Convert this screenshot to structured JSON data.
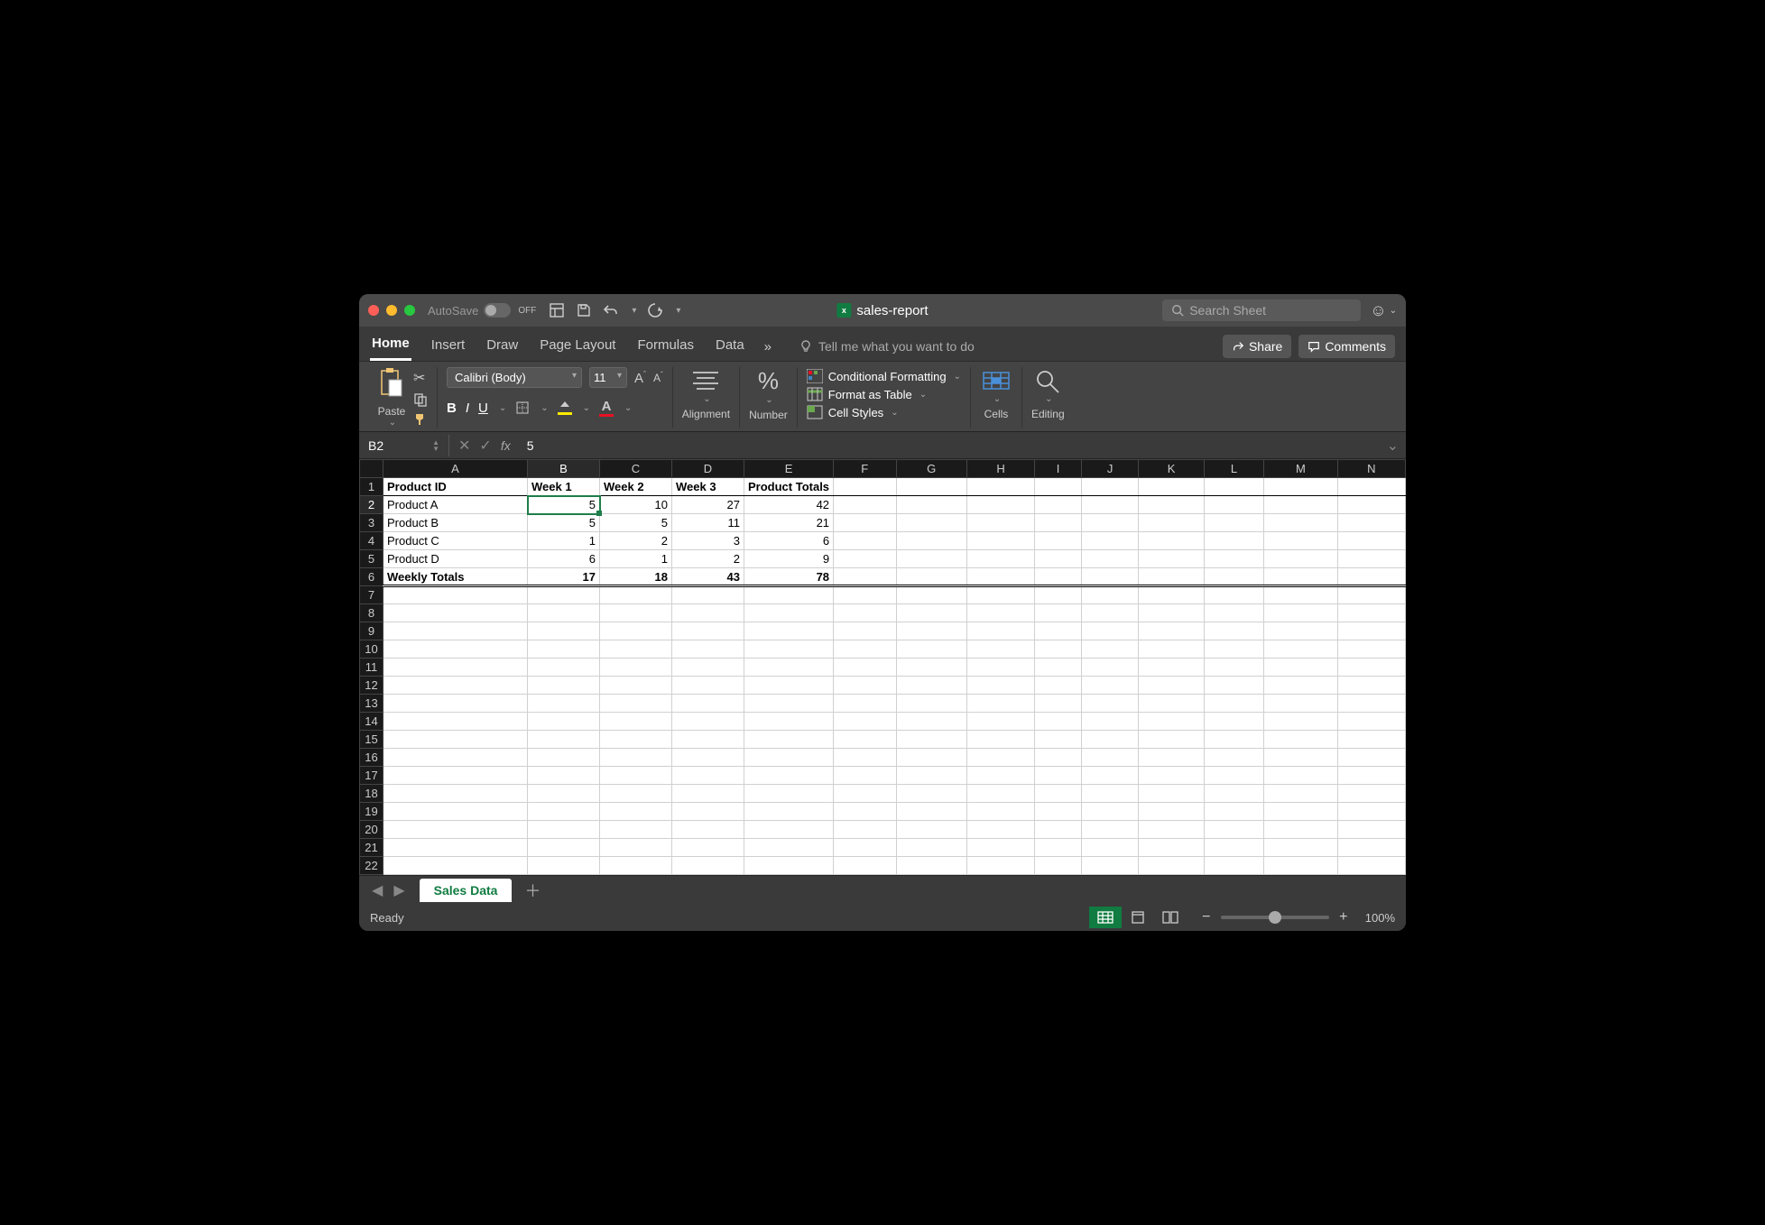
{
  "titlebar": {
    "autosave_label": "AutoSave",
    "autosave_state": "OFF",
    "doc_title": "sales-report",
    "search_placeholder": "Search Sheet"
  },
  "tabs": {
    "items": [
      "Home",
      "Insert",
      "Draw",
      "Page Layout",
      "Formulas",
      "Data"
    ],
    "active": "Home",
    "tell_me_placeholder": "Tell me what you want to do",
    "share": "Share",
    "comments": "Comments"
  },
  "ribbon": {
    "paste": "Paste",
    "font_name": "Calibri (Body)",
    "font_size": "11",
    "alignment": "Alignment",
    "number": "Number",
    "conditional": "Conditional Formatting",
    "table": "Format as Table",
    "styles": "Cell Styles",
    "cells": "Cells",
    "editing": "Editing"
  },
  "formula": {
    "name_box": "B2",
    "value": "5"
  },
  "sheet": {
    "columns": [
      "A",
      "B",
      "C",
      "D",
      "E",
      "F",
      "G",
      "H",
      "I",
      "J",
      "K",
      "L",
      "M",
      "N"
    ],
    "headers": [
      "Product ID",
      "Week 1",
      "Week 2",
      "Week 3",
      "Product Totals"
    ],
    "rows": [
      {
        "label": "Product A",
        "vals": [
          5,
          10,
          27,
          42
        ]
      },
      {
        "label": "Product B",
        "vals": [
          5,
          5,
          11,
          21
        ]
      },
      {
        "label": "Product C",
        "vals": [
          1,
          2,
          3,
          6
        ]
      },
      {
        "label": "Product D",
        "vals": [
          6,
          1,
          2,
          9
        ]
      }
    ],
    "totals_label": "Weekly Totals",
    "totals": [
      17,
      18,
      43,
      78
    ],
    "selected_cell": "B2",
    "visible_rows": 22,
    "tab_name": "Sales Data"
  },
  "status": {
    "ready": "Ready",
    "zoom": "100%"
  },
  "chart_data": {
    "type": "table",
    "title": "sales-report",
    "columns": [
      "Product ID",
      "Week 1",
      "Week 2",
      "Week 3",
      "Product Totals"
    ],
    "rows": [
      [
        "Product A",
        5,
        10,
        27,
        42
      ],
      [
        "Product B",
        5,
        5,
        11,
        21
      ],
      [
        "Product C",
        1,
        2,
        3,
        6
      ],
      [
        "Product D",
        6,
        1,
        2,
        9
      ],
      [
        "Weekly Totals",
        17,
        18,
        43,
        78
      ]
    ]
  }
}
